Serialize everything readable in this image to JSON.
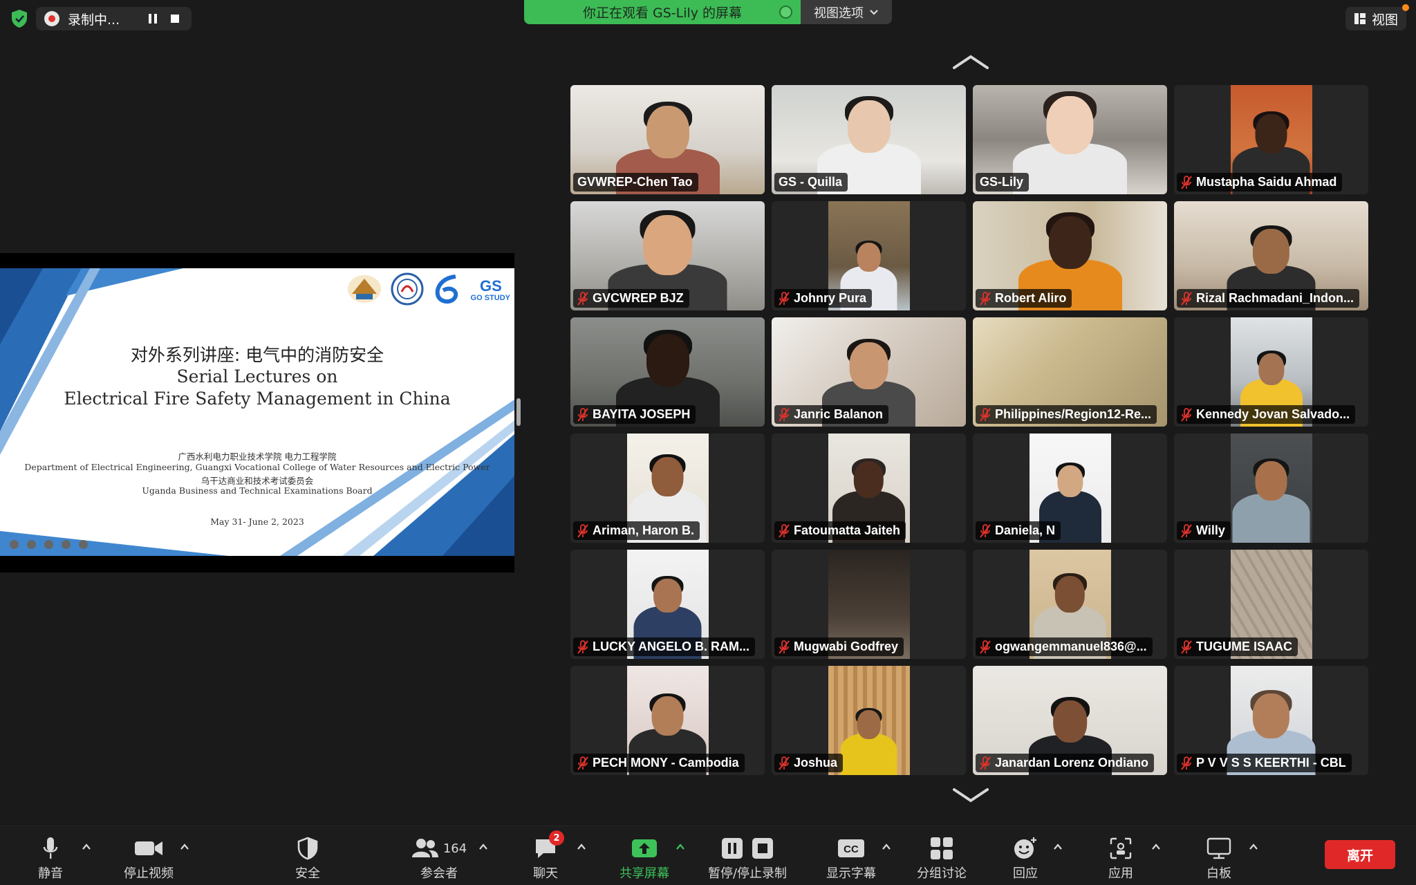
{
  "top_bar": {
    "recording_label": "录制中...",
    "viewing_banner": "你正在观看 GS-Lily 的屏幕",
    "view_options_label": "视图选项",
    "view_label": "视图"
  },
  "colors": {
    "accent_green": "#3dbb55",
    "leave_red": "#e02828",
    "mute_red": "#e0322c",
    "background": "#1a1a1a"
  },
  "slide": {
    "title_cn": "对外系列讲座: 电气中的消防安全",
    "title_en_1": "Serial Lectures on",
    "title_en_2": "Electrical Fire Safety Management in China",
    "org_line_1": "广西水利电力职业技术学院  电力工程学院",
    "org_line_2": "Department of Electrical Engineering, Guangxi Vocational College of Water Resources and Electric Power",
    "org_line_3": "乌干达商业和技术考试委员会",
    "org_line_4": "Uganda Business and Technical Examinations Board",
    "date": "May 31- June 2, 2023",
    "logo_text": "GO STUDY"
  },
  "participants": [
    {
      "name": "GVWREP-Chen Tao",
      "muted": false,
      "active": false
    },
    {
      "name": "GS - Quilla",
      "muted": false,
      "active": true
    },
    {
      "name": "GS-Lily",
      "muted": false,
      "active": false
    },
    {
      "name": "Mustapha Saidu Ahmad",
      "muted": true,
      "active": false
    },
    {
      "name": "GVCWREP BJZ",
      "muted": true,
      "active": false
    },
    {
      "name": "Johnry Pura",
      "muted": true,
      "active": false
    },
    {
      "name": "Robert Aliro",
      "muted": true,
      "active": false
    },
    {
      "name": "Rizal Rachmadani_Indon...",
      "muted": true,
      "active": false
    },
    {
      "name": "BAYITA JOSEPH",
      "muted": true,
      "active": false
    },
    {
      "name": "Janric Balanon",
      "muted": true,
      "active": false
    },
    {
      "name": "Philippines/Region12-Re...",
      "muted": true,
      "active": false
    },
    {
      "name": "Kennedy Jovan Salvado...",
      "muted": true,
      "active": false
    },
    {
      "name": "Ariman, Haron B.",
      "muted": true,
      "active": false
    },
    {
      "name": "Fatoumatta Jaiteh",
      "muted": true,
      "active": false
    },
    {
      "name": "Daniela, N",
      "muted": true,
      "active": false
    },
    {
      "name": "Willy",
      "muted": true,
      "active": false
    },
    {
      "name": "LUCKY ANGELO B. RAM...",
      "muted": true,
      "active": false
    },
    {
      "name": "Mugwabi Godfrey",
      "muted": true,
      "active": false
    },
    {
      "name": "ogwangemmanuel836@...",
      "muted": true,
      "active": false
    },
    {
      "name": "TUGUME ISAAC",
      "muted": true,
      "active": false
    },
    {
      "name": "PECH MONY - Cambodia",
      "muted": true,
      "active": false
    },
    {
      "name": "Joshua",
      "muted": true,
      "active": false
    },
    {
      "name": "Janardan Lorenz Ondiano",
      "muted": true,
      "active": false
    },
    {
      "name": "P V V S S KEERTHI - CBL",
      "muted": true,
      "active": false
    }
  ],
  "toolbar": {
    "mute_label": "静音",
    "stop_video_label": "停止视频",
    "security_label": "安全",
    "participants_label": "参会者",
    "participants_count": "164",
    "chat_label": "聊天",
    "chat_badge": "2",
    "share_label": "共享屏幕",
    "record_label": "暂停/停止录制",
    "captions_label": "显示字幕",
    "captions_icon_text": "CC",
    "breakout_label": "分组讨论",
    "reactions_label": "回应",
    "apps_label": "应用",
    "whiteboard_label": "白板",
    "leave_label": "离开"
  }
}
